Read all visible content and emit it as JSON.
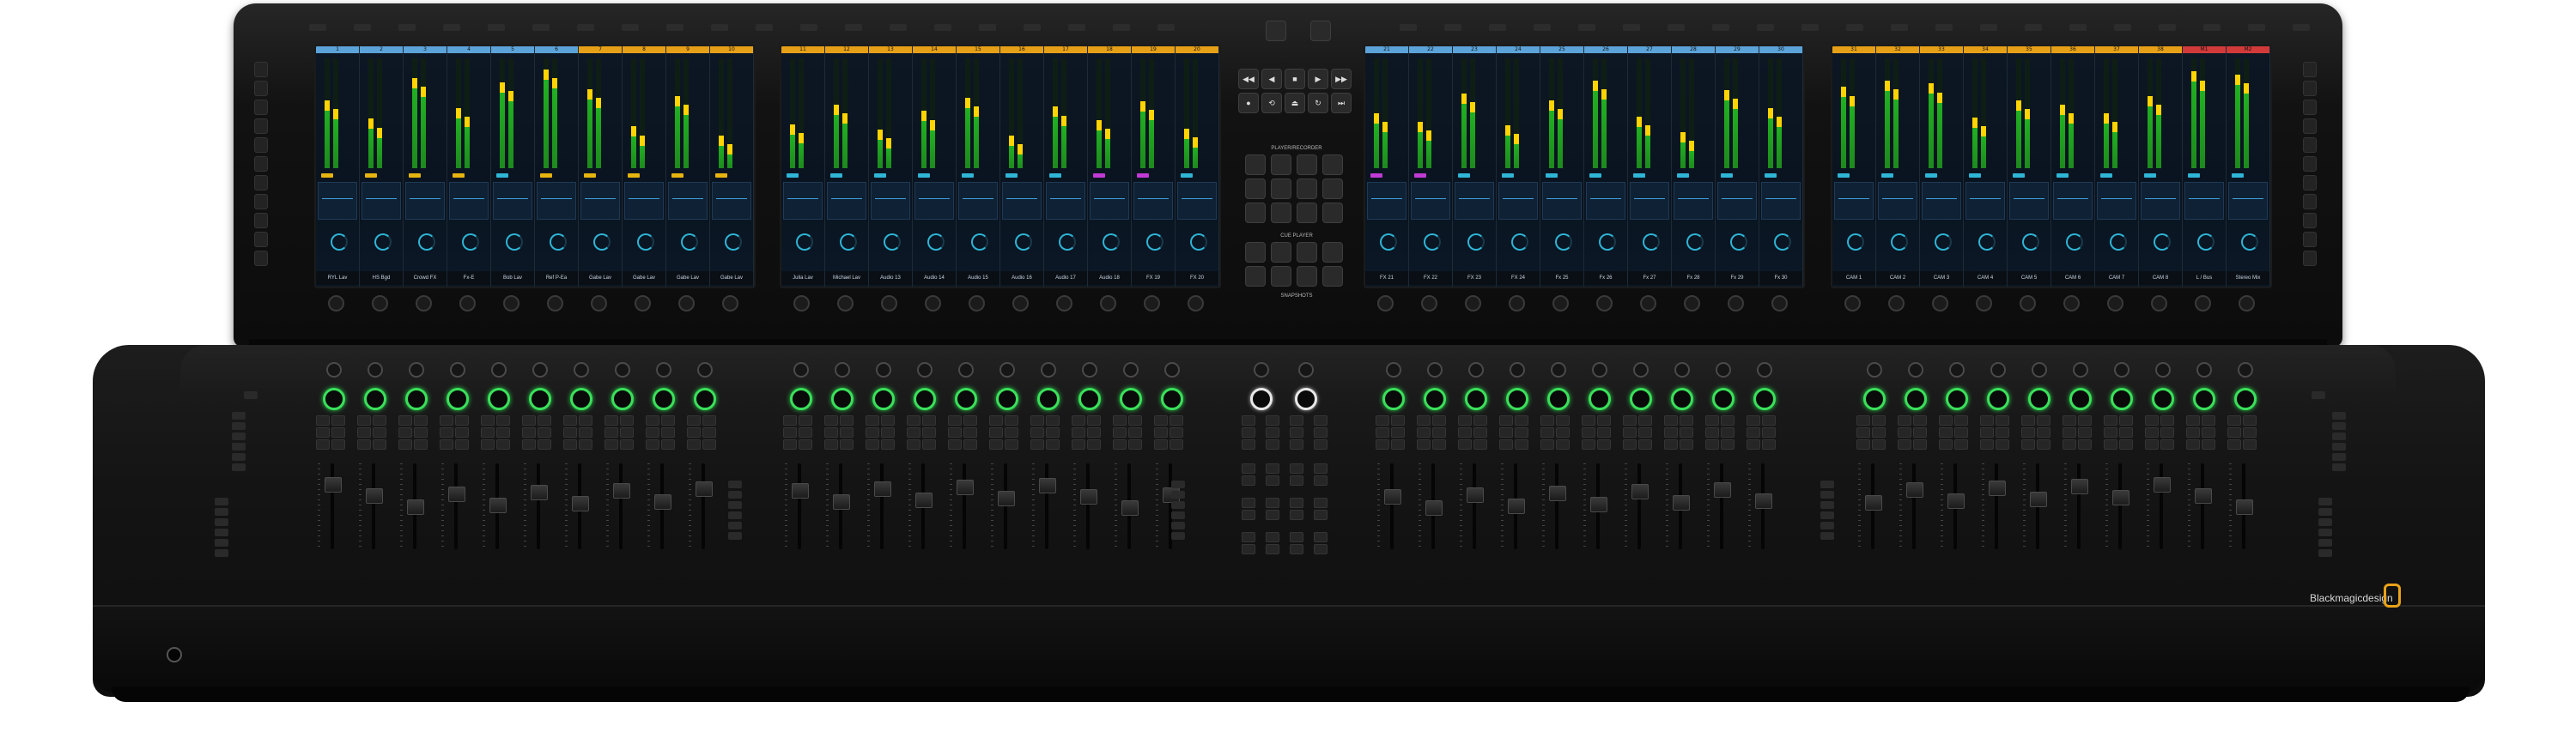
{
  "colors": {
    "meter_green": "#21b021",
    "meter_yellow": "#ffd400",
    "ring_green": "#3ae05a",
    "accent_cyan": "#2fb5d6",
    "logo_orange": "#e9a219"
  },
  "monitor": {
    "screens": [
      {
        "strips": [
          {
            "num": "1",
            "label": "RYL Lav",
            "hdr": "#5ba3d9",
            "level": 0.62,
            "tag": "#e6b410"
          },
          {
            "num": "2",
            "label": "HS Bgd",
            "hdr": "#5ba3d9",
            "level": 0.45,
            "tag": "#e6b410"
          },
          {
            "num": "3",
            "label": "Crowd FX",
            "hdr": "#5ba3d9",
            "level": 0.82,
            "tag": "#e6b410"
          },
          {
            "num": "4",
            "label": "Fx-E",
            "hdr": "#5ba3d9",
            "level": 0.55,
            "tag": "#e6b410"
          },
          {
            "num": "5",
            "label": "Bob Lav",
            "hdr": "#5ba3d9",
            "level": 0.78,
            "tag": "#2fb5d6"
          },
          {
            "num": "6",
            "label": "Ref P-Ea",
            "hdr": "#5ba3d9",
            "level": 0.9,
            "tag": "#e6b410"
          },
          {
            "num": "7",
            "label": "Gabe Lav",
            "hdr": "#e6a017",
            "level": 0.72,
            "tag": "#e6b410"
          },
          {
            "num": "8",
            "label": "Gabe Lav",
            "hdr": "#e6a017",
            "level": 0.38,
            "tag": "#e6b410"
          },
          {
            "num": "9",
            "label": "Gabe Lav",
            "hdr": "#e6a017",
            "level": 0.66,
            "tag": "#e6b410"
          },
          {
            "num": "10",
            "label": "Gabe Lav",
            "hdr": "#e6a017",
            "level": 0.3,
            "tag": "#e6b410"
          }
        ]
      },
      {
        "strips": [
          {
            "num": "11",
            "label": "Julia Lav",
            "hdr": "#e6a017",
            "level": 0.4,
            "tag": "#2fb5d6"
          },
          {
            "num": "12",
            "label": "Michael Lav",
            "hdr": "#e6a017",
            "level": 0.58,
            "tag": "#2fb5d6"
          },
          {
            "num": "13",
            "label": "Audio 13",
            "hdr": "#e6a017",
            "level": 0.35,
            "tag": "#2fb5d6"
          },
          {
            "num": "14",
            "label": "Audio 14",
            "hdr": "#e6a017",
            "level": 0.52,
            "tag": "#2fb5d6"
          },
          {
            "num": "15",
            "label": "Audio 15",
            "hdr": "#e6a017",
            "level": 0.64,
            "tag": "#2fb5d6"
          },
          {
            "num": "16",
            "label": "Audio 16",
            "hdr": "#e6a017",
            "level": 0.3,
            "tag": "#2fb5d6"
          },
          {
            "num": "17",
            "label": "Audio 17",
            "hdr": "#e6a017",
            "level": 0.56,
            "tag": "#2fb5d6"
          },
          {
            "num": "18",
            "label": "Audio 18",
            "hdr": "#e6a017",
            "level": 0.44,
            "tag": "#c23ad6"
          },
          {
            "num": "19",
            "label": "FX 19",
            "hdr": "#e6a017",
            "level": 0.61,
            "tag": "#c23ad6"
          },
          {
            "num": "20",
            "label": "FX 20",
            "hdr": "#e6a017",
            "level": 0.36,
            "tag": "#2fb5d6"
          }
        ]
      },
      {
        "strips": [
          {
            "num": "21",
            "label": "FX 21",
            "hdr": "#5ba3d9",
            "level": 0.5,
            "tag": "#c23ad6"
          },
          {
            "num": "22",
            "label": "FX 22",
            "hdr": "#5ba3d9",
            "level": 0.42,
            "tag": "#c23ad6"
          },
          {
            "num": "23",
            "label": "FX 23",
            "hdr": "#5ba3d9",
            "level": 0.68,
            "tag": "#2fb5d6"
          },
          {
            "num": "24",
            "label": "FX 24",
            "hdr": "#5ba3d9",
            "level": 0.39,
            "tag": "#2fb5d6"
          },
          {
            "num": "25",
            "label": "Fx 25",
            "hdr": "#5ba3d9",
            "level": 0.62,
            "tag": "#2fb5d6"
          },
          {
            "num": "26",
            "label": "Fx 26",
            "hdr": "#5ba3d9",
            "level": 0.8,
            "tag": "#2fb5d6"
          },
          {
            "num": "27",
            "label": "Fx 27",
            "hdr": "#5ba3d9",
            "level": 0.47,
            "tag": "#2fb5d6"
          },
          {
            "num": "28",
            "label": "Fx 28",
            "hdr": "#5ba3d9",
            "level": 0.33,
            "tag": "#2fb5d6"
          },
          {
            "num": "29",
            "label": "Fx 29",
            "hdr": "#5ba3d9",
            "level": 0.71,
            "tag": "#2fb5d6"
          },
          {
            "num": "30",
            "label": "Fx 30",
            "hdr": "#5ba3d9",
            "level": 0.55,
            "tag": "#2fb5d6"
          }
        ]
      },
      {
        "strips": [
          {
            "num": "31",
            "label": "CAM 1",
            "hdr": "#e6a017",
            "level": 0.74,
            "tag": "#2fb5d6"
          },
          {
            "num": "32",
            "label": "CAM 2",
            "hdr": "#e6a017",
            "level": 0.8,
            "tag": "#2fb5d6"
          },
          {
            "num": "33",
            "label": "CAM 3",
            "hdr": "#e6a017",
            "level": 0.77,
            "tag": "#2fb5d6"
          },
          {
            "num": "34",
            "label": "CAM 4",
            "hdr": "#e6a017",
            "level": 0.46,
            "tag": "#2fb5d6"
          },
          {
            "num": "35",
            "label": "CAM 5",
            "hdr": "#e6a017",
            "level": 0.62,
            "tag": "#2fb5d6"
          },
          {
            "num": "36",
            "label": "CAM 6",
            "hdr": "#e6a017",
            "level": 0.58,
            "tag": "#2fb5d6"
          },
          {
            "num": "37",
            "label": "CAM 7",
            "hdr": "#e6a017",
            "level": 0.5,
            "tag": "#2fb5d6"
          },
          {
            "num": "38",
            "label": "CAM 8",
            "hdr": "#e6a017",
            "level": 0.66,
            "tag": "#2fb5d6"
          },
          {
            "num": "M1",
            "label": "L / Bus",
            "hdr": "#d23a3a",
            "level": 0.88,
            "tag": "#2fb5d6"
          },
          {
            "num": "M2",
            "label": "Stereo Mix",
            "hdr": "#d23a3a",
            "level": 0.85,
            "tag": "#2fb5d6"
          }
        ]
      }
    ],
    "center_panel": {
      "top_buttons": 2,
      "sections": [
        "PLAYER/RECORDER",
        "CUE PLAYER",
        "SNAPSHOTS"
      ]
    }
  },
  "desk": {
    "brand": "Blackmagicdesign"
  }
}
